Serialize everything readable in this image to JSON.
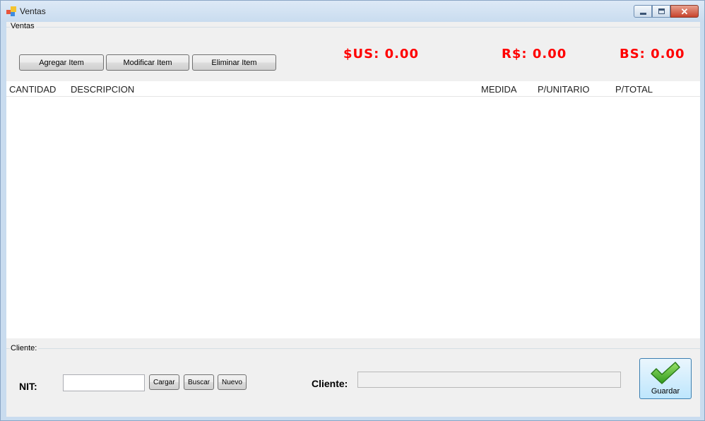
{
  "window": {
    "title": "Ventas",
    "icon": "app-form-icon",
    "controls": {
      "minimize": "minimize-icon",
      "maximize": "maximize-icon",
      "close": "close-icon"
    }
  },
  "ventas_group": {
    "legend": "Ventas",
    "buttons": {
      "add": "Agregar Item",
      "modify": "Modificar Item",
      "delete": "Eliminar Item"
    },
    "totals": {
      "sus": "$US: 0.00",
      "rs": "R$: 0.00",
      "bs": "BS: 0.00"
    },
    "total_color": "#ff0000"
  },
  "items_list": {
    "columns": [
      "CANTIDAD",
      "DESCRIPCION",
      "MEDIDA",
      "P/UNITARIO",
      "P/TOTAL"
    ],
    "rows": []
  },
  "cliente_group": {
    "legend": "Cliente:",
    "nit_label": "NIT:",
    "nit_value": "",
    "buttons": {
      "load": "Cargar",
      "search": "Buscar",
      "new": "Nuevo"
    },
    "cliente_label": "Cliente:",
    "cliente_value": ""
  },
  "save_button": {
    "label": "Guardar",
    "icon": "checkmark-icon"
  }
}
